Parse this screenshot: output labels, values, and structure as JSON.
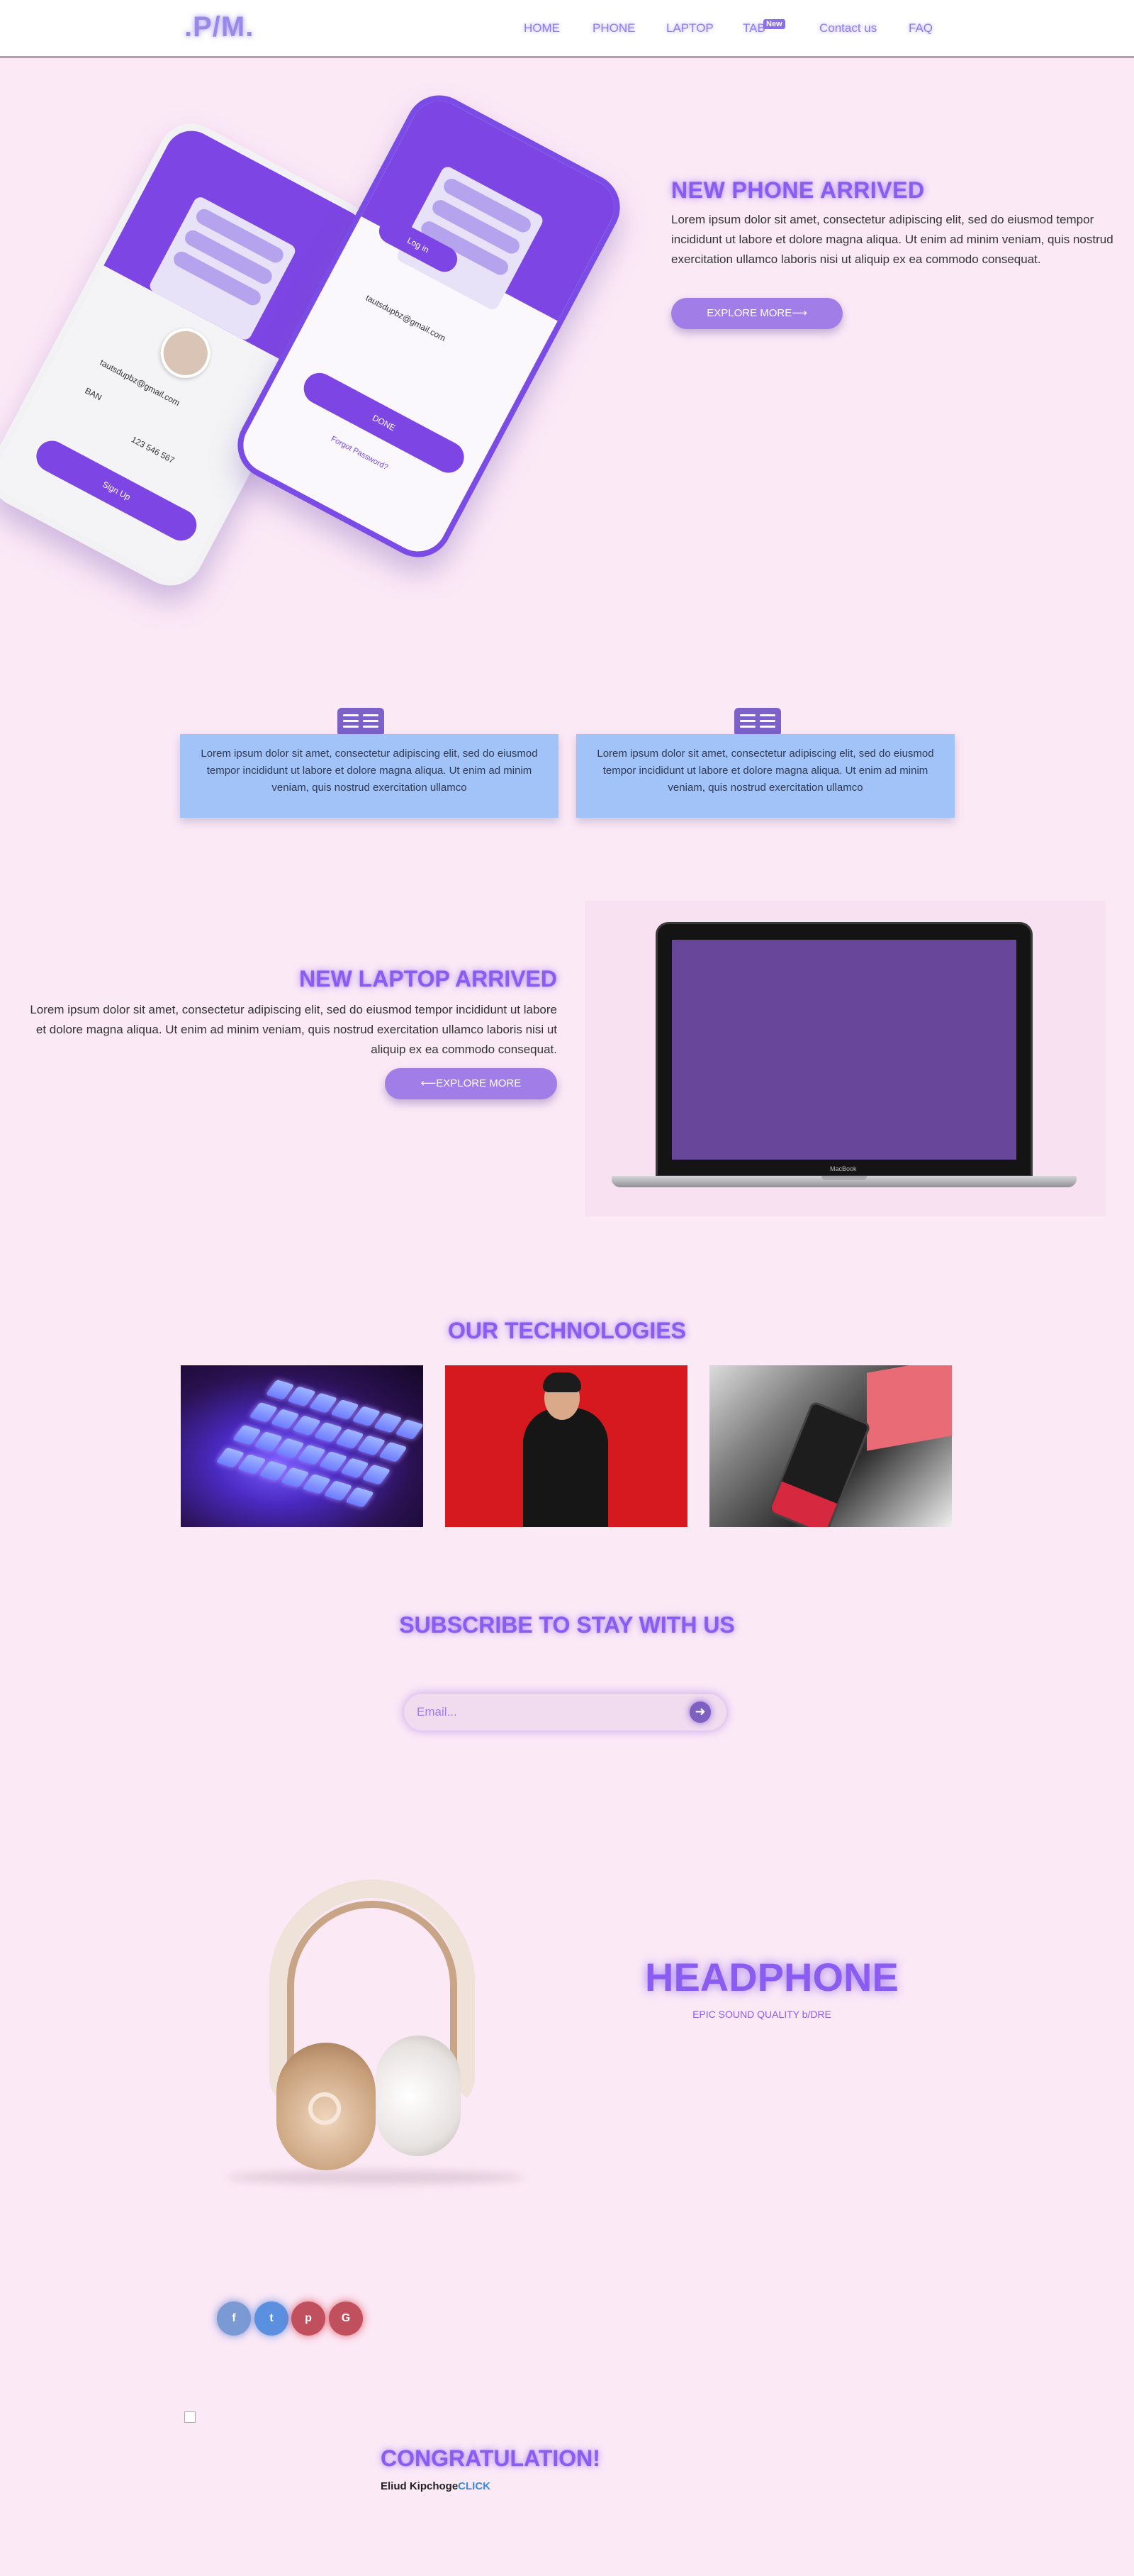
{
  "navbar": {
    "brand": ".P/M.",
    "links": [
      "HOME",
      "PHONE",
      "LAPTOP",
      "TAB",
      "Contact us",
      "FAQ"
    ],
    "badge": "New"
  },
  "phone_section": {
    "title": "NEW PHONE ARRIVED",
    "text": "Lorem ipsum dolor sit amet, consectetur adipiscing elit, sed do eiusmod tempor incididunt ut labore et dolore magna aliqua. Ut enim ad minim veniam, quis nostrud exercitation ullamco laboris nisi ut aliquip ex ea commodo consequat.",
    "button": "EXPLORE MORE⟶",
    "mock": {
      "email": "tautsdupbz@gmail.com",
      "phone": "123 546 567",
      "country": "BAN",
      "signup": "Sign Up",
      "login": "Log in",
      "done": "DONE",
      "forgot": "Forgot Password?",
      "laptop_label": "MacBook"
    }
  },
  "info_cards": [
    {
      "text": "Lorem ipsum dolor sit amet, consectetur adipiscing elit, sed do eiusmod tempor incididunt ut labore et dolore magna aliqua. Ut enim ad minim veniam, quis nostrud exercitation ullamco",
      "icon": "book-icon"
    },
    {
      "text": "Lorem ipsum dolor sit amet, consectetur adipiscing elit, sed do eiusmod tempor incididunt ut labore et dolore magna aliqua. Ut enim ad minim veniam, quis nostrud exercitation ullamco",
      "icon": "book-icon"
    }
  ],
  "laptop_section": {
    "title": "NEW LAPTOP ARRIVED",
    "text": "Lorem ipsum dolor sit amet, consectetur adipiscing elit, sed do eiusmod tempor incididunt ut labore et dolore magna aliqua. Ut enim ad minim veniam, quis nostrud exercitation ullamco laboris nisi ut aliquip ex ea commodo consequat.",
    "button": "⟵EXPLORE MORE"
  },
  "technologies": {
    "title": "OUR TECHNOLOGIES"
  },
  "subscribe": {
    "title": "SUBSCRIBE TO STAY WITH US",
    "placeholder": "Email...",
    "icon": "arrow-right-icon"
  },
  "headphone": {
    "title": "HEADPHONE",
    "subtitle": "EPIC SOUND QUALITY b/DRE"
  },
  "social": [
    {
      "icon": "facebook-icon",
      "glyph": "f",
      "color": "#7b9ad3"
    },
    {
      "icon": "twitter-icon",
      "glyph": "t",
      "color": "#5b8fe0"
    },
    {
      "icon": "pinterest-icon",
      "glyph": "p",
      "color": "#c0505e"
    },
    {
      "icon": "google-icon",
      "glyph": "G",
      "color": "#c0505e"
    }
  ],
  "footer": {
    "title": "CONGRATULATION!",
    "author": "Eliud Kipchoge",
    "link": "CLICK"
  },
  "colors": {
    "background": "#fce9f6",
    "accent": "#8b5cf0",
    "button": "#a17de8",
    "card": "#a2c3f7"
  }
}
